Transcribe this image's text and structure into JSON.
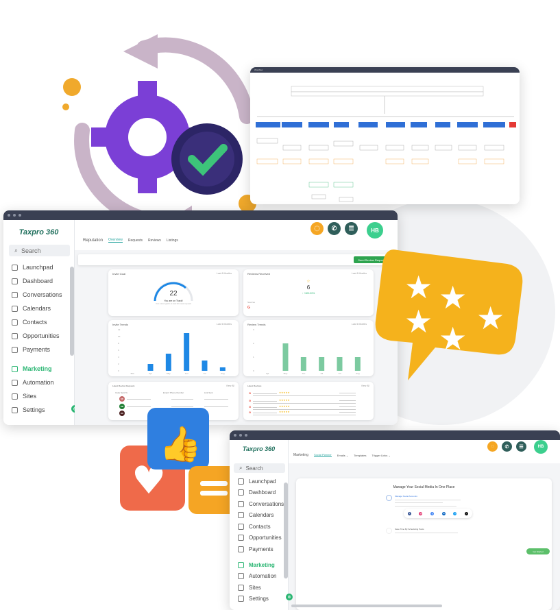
{
  "colors": {
    "brand": "#1f6f5c",
    "accent_green": "#2bb673",
    "bell": "#f5a623",
    "icon_dark": "#2f5e5a",
    "avatar": "#3ccf8e",
    "blue_bar": "#1e88e5",
    "green_bar": "#7ccaa0"
  },
  "workflow_window": {
    "title": "Workflow"
  },
  "main_window": {
    "logo": "Taxpro 360",
    "search": "Search",
    "nav": [
      "Launchpad",
      "Dashboard",
      "Conversations",
      "Calendars",
      "Contacts",
      "Opportunities",
      "Payments",
      "Marketing",
      "Automation",
      "Sites",
      "Settings"
    ],
    "active": "Marketing",
    "avatar": "HB",
    "section": "Reputation",
    "tabs": [
      "Overview",
      "Requests",
      "Reviews",
      "Listings"
    ],
    "send_button": "Send Review Request",
    "invite_goal": {
      "title": "Invite Goal",
      "range": "Last 6 Months",
      "value": "22",
      "caption": "You are on Track!",
      "sub": "Your current goal is to send 20 review requests"
    },
    "reviews_received": {
      "title": "Reviews Received",
      "range": "Last 6 Months",
      "value": "6",
      "change": "↑ +600.00%",
      "sources": "Sources"
    },
    "latest_requests": {
      "title": "Latest Review Requests",
      "view_all": "View All",
      "cols": [
        "Invite Sent To",
        "Email / Phone Number",
        "Link Sent"
      ],
      "avatars": [
        "SR",
        "EM",
        "DO"
      ]
    },
    "latest_reviews": {
      "title": "Latest Reviews",
      "view_all": "View All",
      "rating": "★★★★★"
    }
  },
  "chart_data": [
    {
      "type": "bar",
      "title": "Invite Trends",
      "range": "Last 6 Months",
      "categories": [
        "Mar",
        "Apr",
        "May",
        "Jun",
        "Jul",
        "Aug"
      ],
      "values": [
        0,
        2,
        5,
        11,
        3,
        1
      ],
      "ylim": [
        0,
        12
      ],
      "yticks": [
        0,
        2,
        4,
        6,
        8,
        10,
        12
      ]
    },
    {
      "type": "bar",
      "title": "Review Trends",
      "range": "Last 6 Months",
      "categories": [
        "Apr",
        "May",
        "Jun",
        "Jul",
        "Jul",
        "Aug"
      ],
      "values": [
        0,
        2,
        1,
        1,
        1,
        1
      ],
      "ylim": [
        0,
        3
      ],
      "yticks": [
        0,
        1,
        2,
        3
      ]
    }
  ],
  "social_window": {
    "logo": "Taxpro 360",
    "search": "Search",
    "nav": [
      "Launchpad",
      "Dashboard",
      "Conversations",
      "Calendars",
      "Contacts",
      "Opportunities",
      "Payments",
      "Marketing",
      "Automation",
      "Sites",
      "Settings"
    ],
    "active": "Marketing",
    "avatar": "HB",
    "section": "Marketing",
    "tabs": [
      "Social Planner",
      "Emails ⌄",
      "Templates",
      "Trigger Links ⌄"
    ],
    "heading": "Manage Your Social Media In One Place",
    "step1": "Manage Social Accounts",
    "step2": "Save Time By Scheduling Posts",
    "socials": [
      "facebook",
      "instagram",
      "google",
      "linkedin",
      "twitter",
      "tiktok"
    ],
    "cta": "Get Started"
  }
}
